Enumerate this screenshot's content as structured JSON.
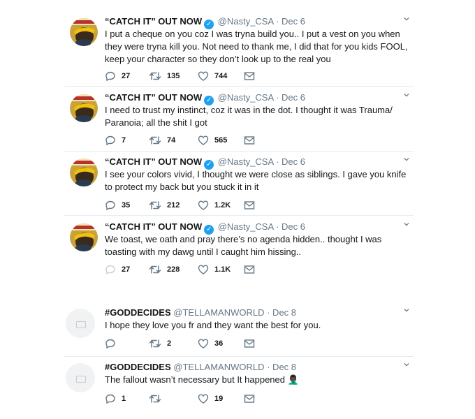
{
  "tweets": [
    {
      "name": "“CATCH IT” OUT NOW",
      "handle": "@Nasty_CSA",
      "date": "· Dec 6",
      "text": "I put a cheque on you coz I was tryna build you.. I put a vest on you when they were tryna kill you.  Not need to thank me, I did that for you kids FOOL, keep your character so they don’t look up to the real you",
      "replies": "27",
      "retweets": "135",
      "likes": "744"
    },
    {
      "name": "“CATCH IT” OUT NOW",
      "handle": "@Nasty_CSA",
      "date": "· Dec 6",
      "text": "I need to trust my instinct, coz it was in the dot. I thought it was Trauma/ Paranoia; all the shit I got",
      "replies": "7",
      "retweets": "74",
      "likes": "565"
    },
    {
      "name": "“CATCH IT” OUT NOW",
      "handle": "@Nasty_CSA",
      "date": "· Dec 6",
      "text": "I see your colors vivid, I thought we were close as siblings.  I gave you knife to protect my back but you stuck it in it",
      "replies": "35",
      "retweets": "212",
      "likes": "1.2K"
    },
    {
      "name": "“CATCH IT” OUT NOW",
      "handle": "@Nasty_CSA",
      "date": "· Dec 6",
      "text": "We toast, we oath and pray there’s no agenda hidden.. thought I was toasting with my dawg until I caught him hissing..",
      "replies": "27",
      "retweets": "228",
      "likes": "1.1K"
    },
    {
      "name": "#GODDECIDES",
      "handle": "@TELLAMANWORLD",
      "date": "· Dec 8",
      "text": "I hope they love you fr and they want the best for you.",
      "replies": "",
      "retweets": "2",
      "likes": "36"
    },
    {
      "name": "#GODDECIDES",
      "handle": "@TELLAMANWORLD",
      "date": "· Dec 8",
      "text": "The fallout wasn’t necessary but It happened 🤦🏿‍♂️",
      "replies": "1",
      "retweets": "",
      "likes": "19"
    }
  ],
  "colors": {
    "verified": "#1da1f2",
    "secondary_text": "#657786",
    "divider": "#e6ecf0"
  }
}
